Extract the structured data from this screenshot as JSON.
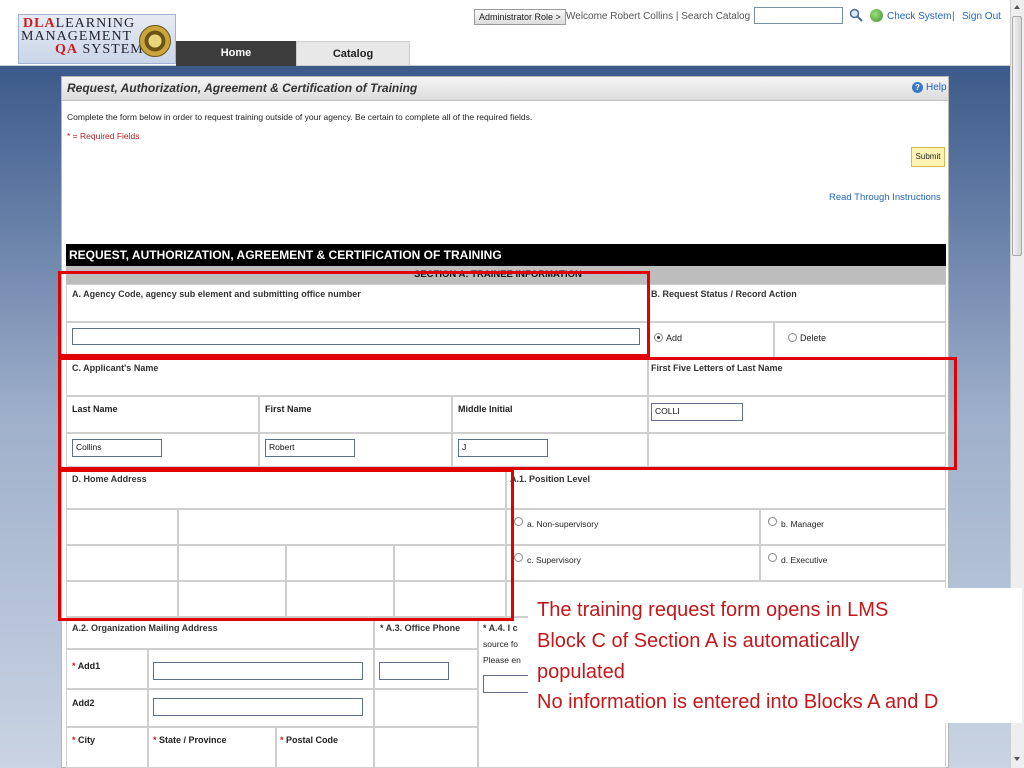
{
  "header": {
    "logo": {
      "line1_red": "DLA",
      "line1": "LEARNING",
      "line2": "MANAGEMENT",
      "line3_red": "QA",
      "line3": "SYSTEM"
    },
    "tabs": [
      {
        "label": "Home"
      },
      {
        "label": "Catalog"
      }
    ],
    "admin_role": "Administrator Role >",
    "welcome_text": "Welcome Robert Collins | Search Catalog",
    "search_placeholder": "",
    "check_system": "Check System",
    "separator": "|",
    "sign_out": "Sign Out"
  },
  "page": {
    "title": "Request, Authorization, Agreement & Certification of Training",
    "help": "Help",
    "intro": "Complete the form below in order to request training outside of your agency. Be certain to complete all of the required fields.",
    "required_note": "* = Required Fields",
    "submit": "Submit",
    "read_through": "Read Through Instructions"
  },
  "form": {
    "title": "REQUEST, AUTHORIZATION, AGREEMENT & CERTIFICATION OF TRAINING",
    "section": "SECTION A: TRAINEE INFORMATION",
    "block_a_label": "A. Agency Code, agency sub element and submitting office number",
    "block_a_value": "",
    "block_b_label": "B. Request Status / Record Action",
    "status_add": "Add",
    "status_delete": "Delete",
    "block_c_label": "C.   Applicant's Name",
    "first_five_label": "First Five Letters of Last Name",
    "first_five_value": "COLLI",
    "last_name_label": "Last Name",
    "first_name_label": "First Name",
    "middle_initial_label": "Middle Initial",
    "last_name_value": "Collins",
    "first_name_value": "Robert",
    "middle_initial_value": "J",
    "block_d_label": "D.  Home Address",
    "a1_label": "A.1. Position Level",
    "positions": [
      "a. Non-supervisory",
      "b. Manager",
      "c. Supervisory",
      "d. Executive"
    ],
    "a2_label": "A.2. Organization Mailing Address",
    "a3_label": "* A.3. Office Phone",
    "a4_label": "* A.4. I c",
    "a4_line2": "source fo",
    "a4_line3": "Please en",
    "add1_label": "Add1",
    "add2_label": "Add2",
    "city_label": "City",
    "state_label": "State / Province",
    "postal_label": "Postal Code",
    "required_mark": "*"
  },
  "callout": {
    "lines": [
      "The training request form opens in LMS",
      "Block C of Section A is automatically",
      "populated",
      "No information is entered into Blocks A and D"
    ]
  },
  "colors": {
    "accent_red": "#e00000",
    "link_blue": "#2466b8",
    "header_black": "#000000"
  }
}
